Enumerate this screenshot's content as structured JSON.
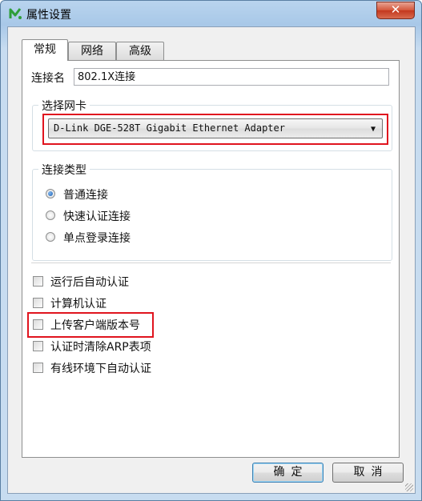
{
  "window": {
    "title": "属性设置",
    "close_label": "✕"
  },
  "tabs": [
    {
      "label": "常规",
      "active": true
    },
    {
      "label": "网络",
      "active": false
    },
    {
      "label": "高级",
      "active": false
    }
  ],
  "connection_name": {
    "label": "连接名",
    "value": "802.1X连接"
  },
  "adapter_group": {
    "title": "选择网卡",
    "selected": "D-Link DGE-528T Gigabit Ethernet Adapter"
  },
  "connection_type": {
    "title": "连接类型",
    "options": [
      {
        "label": "普通连接",
        "selected": true
      },
      {
        "label": "快速认证连接",
        "selected": false
      },
      {
        "label": "单点登录连接",
        "selected": false
      }
    ]
  },
  "checkboxes": [
    {
      "label": "运行后自动认证",
      "checked": false
    },
    {
      "label": "计算机认证",
      "checked": false
    },
    {
      "label": "上传客户端版本号",
      "checked": false
    },
    {
      "label": "认证时清除ARP表项",
      "checked": false
    },
    {
      "label": "有线环境下自动认证",
      "checked": false
    }
  ],
  "buttons": {
    "ok": "确定",
    "cancel": "取消"
  },
  "colors": {
    "highlight": "#e0141e",
    "title_bar": "#a8c8e8",
    "radio_dot": "#1c5fb0"
  }
}
